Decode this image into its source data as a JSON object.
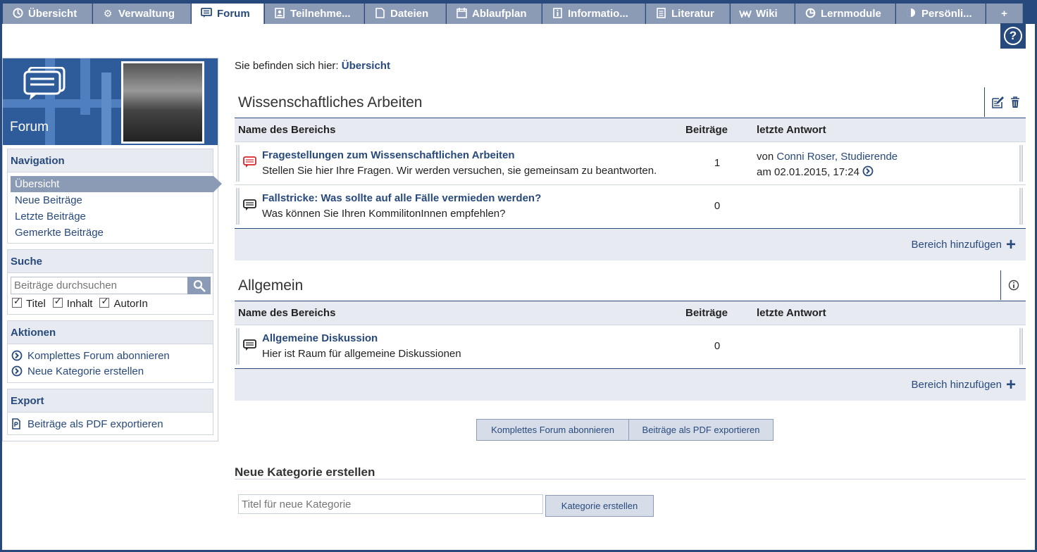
{
  "tabs": [
    {
      "label": "Übersicht",
      "icon": "overview-icon"
    },
    {
      "label": "Verwaltung",
      "icon": "gears-icon"
    },
    {
      "label": "Forum",
      "icon": "chat-icon"
    },
    {
      "label": "Teilnehme...",
      "icon": "person-icon"
    },
    {
      "label": "Dateien",
      "icon": "file-icon"
    },
    {
      "label": "Ablaufplan",
      "icon": "calendar-icon"
    },
    {
      "label": "Informatio...",
      "icon": "info-icon"
    },
    {
      "label": "Literatur",
      "icon": "book-icon"
    },
    {
      "label": "Wiki",
      "icon": "wiki-icon"
    },
    {
      "label": "Lernmodule",
      "icon": "module-icon"
    },
    {
      "label": "Persönli...",
      "icon": "personal-icon"
    },
    {
      "label": "+",
      "icon": ""
    }
  ],
  "active_tab": "Forum",
  "sidebar": {
    "banner_title": "Forum",
    "navigation": {
      "header": "Navigation",
      "items": [
        "Übersicht",
        "Neue Beiträge",
        "Letzte Beiträge",
        "Gemerkte Beiträge"
      ]
    },
    "search": {
      "header": "Suche",
      "placeholder": "Beiträge durchsuchen",
      "options": [
        "Titel",
        "Inhalt",
        "AutorIn"
      ]
    },
    "actions": {
      "header": "Aktionen",
      "items": [
        "Komplettes Forum abonnieren",
        "Neue Kategorie erstellen"
      ]
    },
    "export": {
      "header": "Export",
      "items": [
        "Beiträge als PDF exportieren"
      ]
    }
  },
  "breadcrumb": {
    "prefix": "Sie befinden sich hier:",
    "current": "Übersicht"
  },
  "table_headers": {
    "name": "Name des Bereichs",
    "posts": "Beiträge",
    "last": "letzte Antwort"
  },
  "categories": [
    {
      "title": "Wissenschaftliches Arbeiten",
      "areas": [
        {
          "title": "Fragestellungen zum Wissenschaftlichen Arbeiten",
          "description": "Stellen Sie hier Ihre Fragen. Wir werden versuchen, sie gemeinsam zu beantworten.",
          "posts": "1",
          "last_by_prefix": "von",
          "last_by": "Conni Roser, Studierende",
          "last_date": "am 02.01.2015, 17:24",
          "unread": true
        },
        {
          "title": "Fallstricke: Was sollte auf alle Fälle vermieden werden?",
          "description": "Was können Sie Ihren KommilitonInnen empfehlen?",
          "posts": "0"
        }
      ],
      "add_label": "Bereich hinzufügen"
    },
    {
      "title": "Allgemein",
      "areas": [
        {
          "title": "Allgemeine Diskussion",
          "description": "Hier ist Raum für allgemeine Diskussionen",
          "posts": "0"
        }
      ],
      "add_label": "Bereich hinzufügen"
    }
  ],
  "bottom_buttons": {
    "subscribe": "Komplettes Forum abonnieren",
    "export": "Beiträge als PDF exportieren"
  },
  "new_category": {
    "title": "Neue Kategorie erstellen",
    "placeholder": "Titel für neue Kategorie",
    "button": "Kategorie erstellen"
  },
  "colors": {
    "brand": "#28497c",
    "tab_inactive": "#8b9bb5",
    "header_bg": "#e7ebf1",
    "unread_icon": "#d9262c"
  }
}
